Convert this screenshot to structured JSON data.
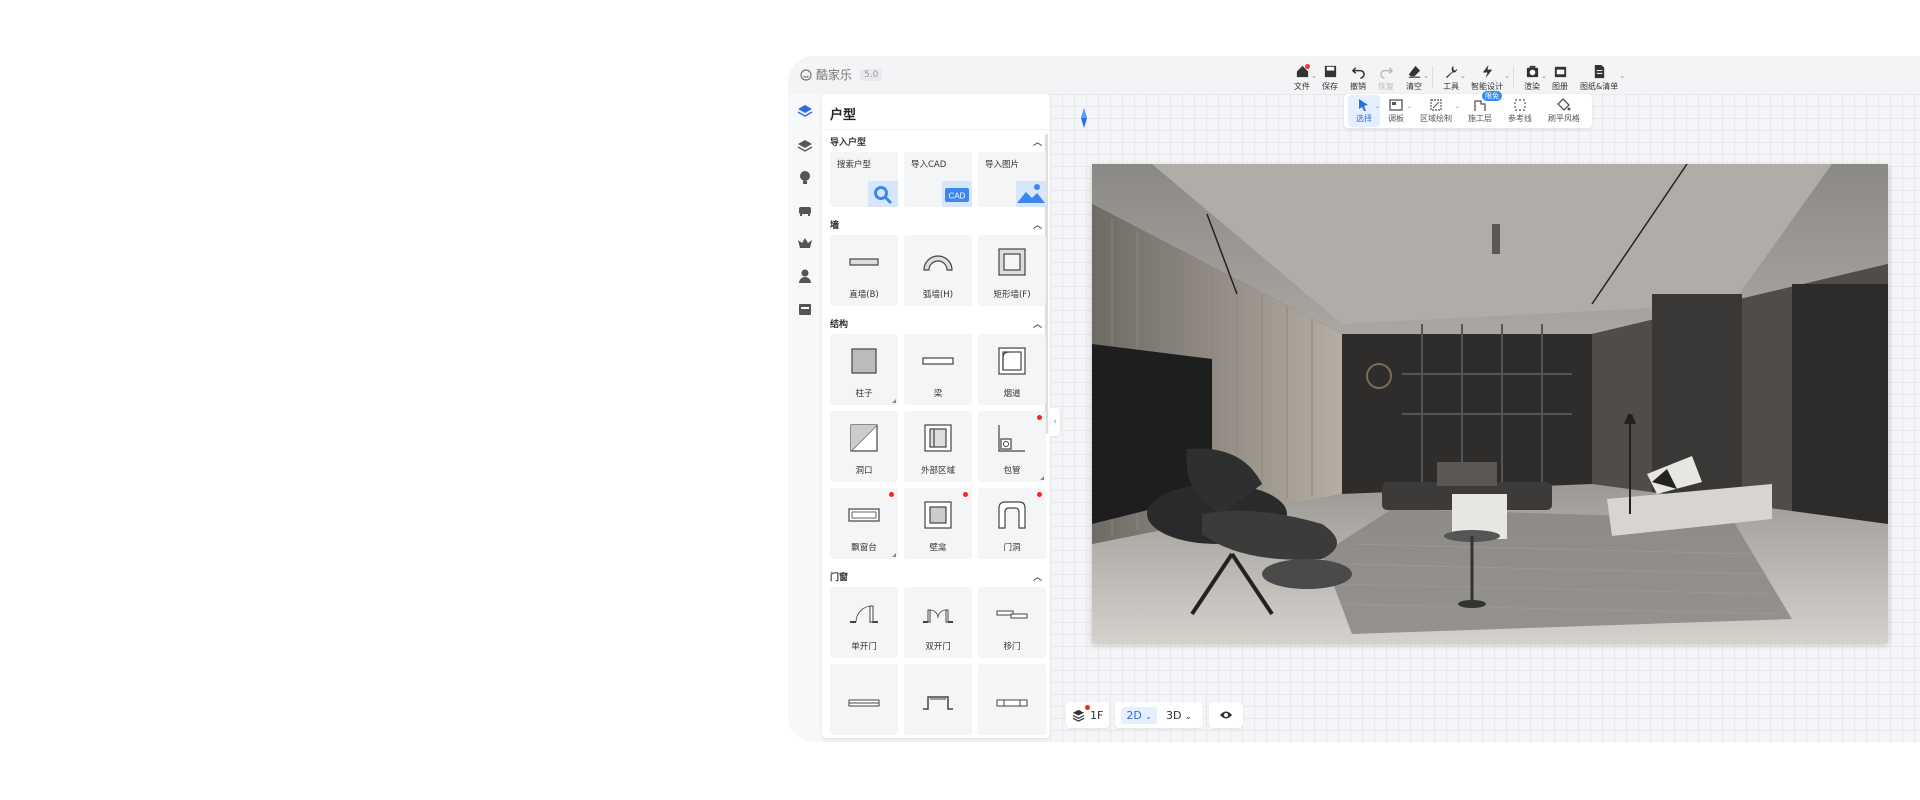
{
  "app": {
    "logo_text": "酷家乐",
    "version": "5.0"
  },
  "toolbar": [
    {
      "label": "文件",
      "icon": "home-icon",
      "dot": true,
      "arrow": true
    },
    {
      "label": "保存",
      "icon": "save-icon"
    },
    {
      "label": "撤销",
      "icon": "undo-icon"
    },
    {
      "label": "恢复",
      "icon": "redo-icon",
      "disabled": true
    },
    {
      "label": "清空",
      "icon": "eraser-icon",
      "arrow": true
    },
    {
      "label": "工具",
      "icon": "wrench-icon",
      "arrow": true
    },
    {
      "label": "智能设计",
      "icon": "lightning-icon",
      "arrow": true
    },
    {
      "label": "渲染",
      "icon": "camera-icon",
      "arrow": true
    },
    {
      "label": "图册",
      "icon": "album-icon"
    },
    {
      "label": "图纸&清单",
      "icon": "document-icon",
      "arrow": true
    }
  ],
  "subtoolbar": [
    {
      "label": "选择",
      "icon": "cursor-icon",
      "active": true,
      "arrow": true
    },
    {
      "label": "调板",
      "icon": "palette-icon",
      "arrow": true
    },
    {
      "label": "区域绘制",
      "icon": "region-draw-icon",
      "arrow": true
    },
    {
      "label": "施工层",
      "icon": "construction-layer-icon",
      "badge": "限免"
    },
    {
      "label": "参考线",
      "icon": "guide-line-icon"
    },
    {
      "label": "刷平风格",
      "icon": "paint-bucket-icon"
    }
  ],
  "leftnav": [
    "floorplan-icon",
    "hardware-icon",
    "lighting-icon",
    "furniture-icon",
    "crown-icon",
    "user-icon",
    "store-icon"
  ],
  "panel": {
    "title": "户型",
    "import": {
      "title": "导入户型",
      "items": [
        {
          "label": "搜索户型",
          "icon": "search-floorplan-icon"
        },
        {
          "label": "导入CAD",
          "icon": "cad-icon",
          "tag": "CAD"
        },
        {
          "label": "导入图片",
          "icon": "image-import-icon"
        }
      ]
    },
    "wall": {
      "title": "墙",
      "items": [
        {
          "label": "直墙(B)",
          "icon": "straight-wall-icon"
        },
        {
          "label": "弧墙(H)",
          "icon": "arc-wall-icon"
        },
        {
          "label": "矩形墙(F)",
          "icon": "rect-wall-icon"
        }
      ]
    },
    "structure": {
      "title": "结构",
      "items": [
        {
          "label": "柱子",
          "icon": "column-icon",
          "corner": true
        },
        {
          "label": "梁",
          "icon": "beam-icon"
        },
        {
          "label": "烟道",
          "icon": "flue-icon"
        },
        {
          "label": "洞口",
          "icon": "opening-icon"
        },
        {
          "label": "外部区域",
          "icon": "outer-area-icon"
        },
        {
          "label": "包管",
          "icon": "pipe-cover-icon",
          "dot": true,
          "corner": true
        },
        {
          "label": "飘窗台",
          "icon": "bay-window-icon",
          "dot": true,
          "corner": true
        },
        {
          "label": "壁龛",
          "icon": "niche-icon",
          "dot": true
        },
        {
          "label": "门洞",
          "icon": "doorway-icon",
          "dot": true
        }
      ]
    },
    "doors": {
      "title": "门窗",
      "items": [
        {
          "label": "单开门",
          "icon": "single-door-icon"
        },
        {
          "label": "双开门",
          "icon": "double-door-icon"
        },
        {
          "label": "移门",
          "icon": "sliding-door-icon"
        },
        {
          "label": "",
          "icon": "window-icon"
        },
        {
          "label": "",
          "icon": "bay-window-frame-icon"
        },
        {
          "label": "",
          "icon": "casement-window-icon"
        }
      ]
    }
  },
  "bottombar": {
    "floor": "1F",
    "view_2d": "2D",
    "view_3d": "3D"
  },
  "colors": {
    "accent": "#2b6de3",
    "badge": "#2b8cff",
    "dot": "#ff2222"
  }
}
